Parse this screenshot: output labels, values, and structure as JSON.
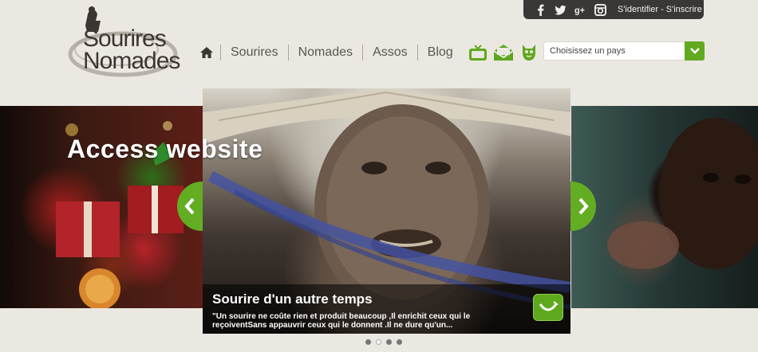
{
  "topbar": {
    "social": [
      "facebook-icon",
      "twitter-icon",
      "google-plus-icon",
      "instagram-icon"
    ],
    "login": "S'identifier",
    "separator": " - ",
    "register": "S'inscrire"
  },
  "logo": {
    "line1": "Sourires",
    "line2": "Nomades"
  },
  "nav": {
    "items": [
      "Sourires",
      "Nomades",
      "Assos",
      "Blog"
    ],
    "icons": [
      "tv-icon",
      "mail-icon",
      "mascot-icon"
    ]
  },
  "country_select": {
    "value": "Choisissez un pays"
  },
  "carousel": {
    "left_title": "Access website",
    "slide_title": "Sourire d'un autre temps",
    "slide_text": "\"Un sourire ne coûte rien et produit beaucoup ,Il enrichit ceux qui le reçoiventSans appauvrir ceux qui le donnent .Il ne dure qu'un...",
    "dots": 4,
    "active_dot": 1
  },
  "colors": {
    "accent_green": "#62a920",
    "topbar_bg": "#3b3735",
    "page_bg": "#ebe8e2"
  }
}
